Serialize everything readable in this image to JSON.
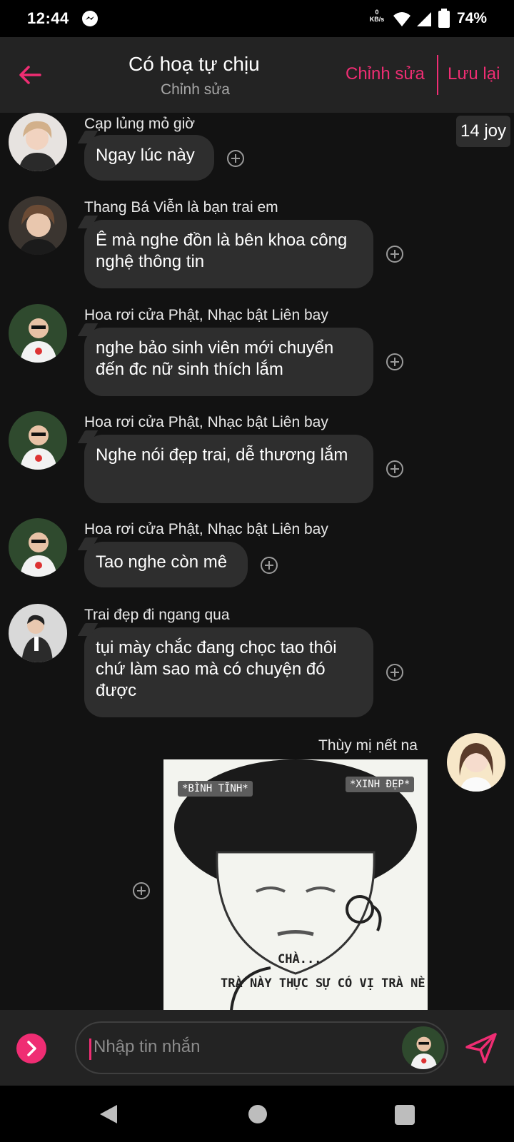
{
  "status_bar": {
    "time": "12:44",
    "kbs_value": "0",
    "kbs_unit": "KB/s",
    "battery": "74%"
  },
  "header": {
    "title": "Có hoạ tự chịu",
    "subtitle": "Chỉnh sửa",
    "edit_label": "Chỉnh sửa",
    "save_label": "Lưu lại"
  },
  "badge": "14 joy",
  "messages": [
    {
      "sender": "Cạp lủng mỏ giờ",
      "text": "Ngay lúc này"
    },
    {
      "sender": "Thang Bá Viễn là bạn trai em",
      "text": "Ê mà nghe đồn là bên khoa công nghệ thông tin"
    },
    {
      "sender": "Hoa rơi cửa Phật, Nhạc bật Liên bay",
      "text": "nghe bảo sinh viên mới chuyển đến đc nữ sinh thích lắm"
    },
    {
      "sender": "Hoa rơi cửa Phật, Nhạc bật Liên bay",
      "text": "Nghe nói đẹp trai, dễ thương lắm"
    },
    {
      "sender": "Hoa rơi cửa Phật, Nhạc bật Liên bay",
      "text": "Tao nghe còn mê"
    },
    {
      "sender": "Trai đẹp đi ngang qua",
      "text": "tụi mày chắc đang chọc tao thôi chứ làm sao mà có chuyện đó được"
    }
  ],
  "own_message": {
    "sender": "Thùy mị nết na",
    "sticker": {
      "tag_left": "*BÌNH TĨNH*",
      "tag_right": "*XINH ĐẸP*",
      "caption_1": "CHÀ...",
      "caption_2": "TRÀ NÀY THỰC SỰ CÓ VỊ TRÀ NÈ."
    }
  },
  "composer": {
    "placeholder": "Nhập tin nhắn"
  },
  "colors": {
    "accent": "#ef2d73",
    "background": "#121212",
    "bubble": "#2e2e2e",
    "header": "#232323"
  },
  "icons": [
    "messenger-icon",
    "wifi-icon",
    "signal-icon",
    "battery-icon",
    "back-arrow-icon",
    "add-reaction-icon",
    "chevron-right-icon",
    "send-icon",
    "nav-back-icon",
    "nav-home-icon",
    "nav-recent-icon"
  ]
}
